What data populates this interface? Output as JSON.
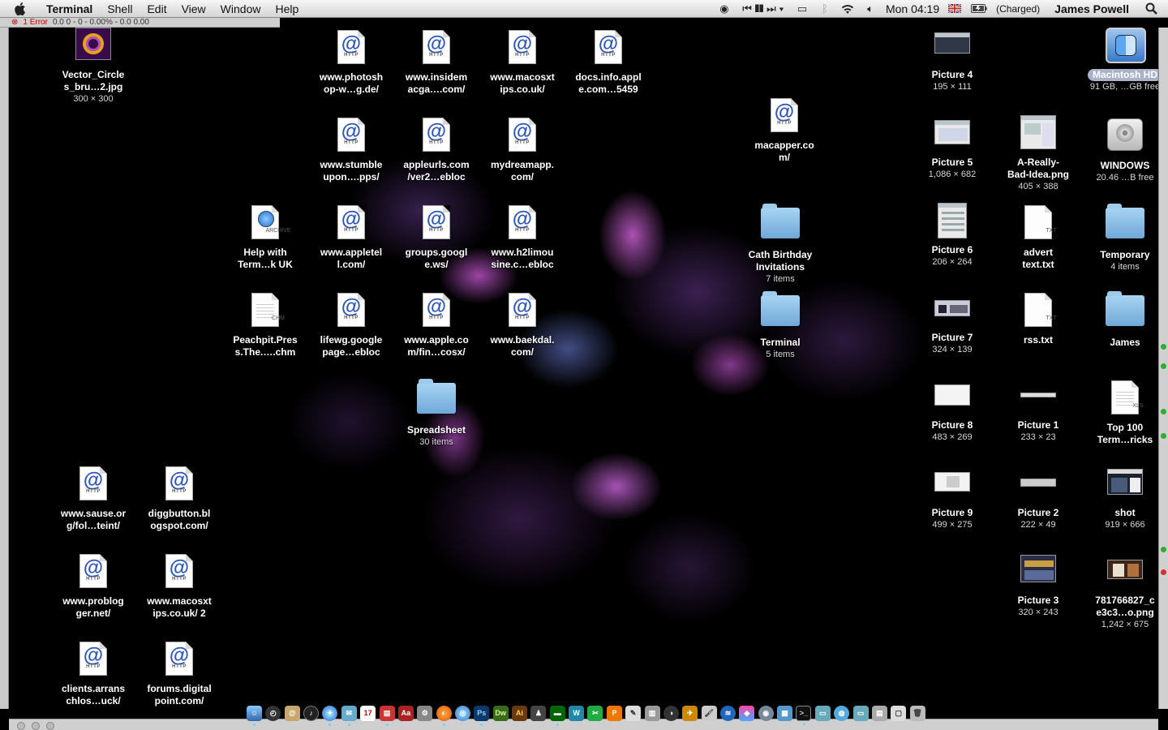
{
  "menubar": {
    "app_name": "Terminal",
    "menus": [
      "Shell",
      "Edit",
      "View",
      "Window",
      "Help"
    ],
    "clock": "Mon 04:19",
    "battery_status": "(Charged)",
    "user": "James Powell",
    "icons": [
      "apple-logo-icon",
      "activity-icon",
      "media-controls-icon",
      "display-icon",
      "bluetooth-icon",
      "wifi-icon",
      "volume-icon",
      "uk-flag-icon",
      "battery-icon",
      "spotlight-icon"
    ]
  },
  "background_window": {
    "error_text": "1 Error",
    "status_text": "0.0    0 - 0 - 0.00%  - 0.0 0.00"
  },
  "desktop": {
    "icons_left": [
      {
        "name": "Vector_Circles_bru…2.jpg",
        "line1": "Vector_Circle",
        "line2": "s_bru…2.jpg",
        "meta": "300 × 300",
        "type": "image"
      },
      {
        "line1": "www.sause.or",
        "line2": "g/fol…teint/",
        "type": "http"
      },
      {
        "line1": "diggbutton.bl",
        "line2": "ogspot.com/",
        "type": "http"
      },
      {
        "line1": "www.problog",
        "line2": "ger.net/",
        "type": "http"
      },
      {
        "line1": "www.macosxt",
        "line2": "ips.co.uk/ 2",
        "type": "http"
      },
      {
        "line1": "clients.arrans",
        "line2": "chlos…uck/",
        "type": "http"
      },
      {
        "line1": "forums.digital",
        "line2": "point.com/",
        "type": "http"
      }
    ],
    "icons_middle": [
      {
        "line1": "www.photosh",
        "line2": "op-w…g.de/",
        "type": "http"
      },
      {
        "line1": "www.insidem",
        "line2": "acga….com/",
        "type": "http"
      },
      {
        "line1": "www.macosxt",
        "line2": "ips.co.uk/",
        "type": "http"
      },
      {
        "line1": "docs.info.appl",
        "line2": "e.com…5459",
        "type": "http"
      },
      {
        "line1": "www.stumble",
        "line2": "upon….pps/",
        "type": "http"
      },
      {
        "line1": "appleurls.com",
        "line2": "/ver2…ebloc",
        "type": "http"
      },
      {
        "line1": "mydreamapp.",
        "line2": "com/",
        "type": "http"
      },
      {
        "line1": "Help with",
        "line2": "Term…k UK",
        "type": "archive"
      },
      {
        "line1": "www.appletel",
        "line2": "l.com/",
        "type": "http"
      },
      {
        "line1": "groups.googl",
        "line2": "e.ws/",
        "type": "http"
      },
      {
        "line1": "www.h2limou",
        "line2": "sine.c…ebloc",
        "type": "http"
      },
      {
        "line1": "Peachpit.Pres",
        "line2": "s.The.….chm",
        "type": "chm"
      },
      {
        "line1": "lifewg.google",
        "line2": "page…ebloc",
        "type": "http"
      },
      {
        "line1": "www.apple.co",
        "line2": "m/fin…cosx/",
        "type": "http"
      },
      {
        "line1": "www.baekdal.",
        "line2": "com/",
        "type": "http"
      },
      {
        "line1": "Spreadsheet",
        "line2": "",
        "meta": "30 items",
        "type": "folder"
      },
      {
        "line1": "macapper.co",
        "line2": "m/",
        "type": "http"
      },
      {
        "line1": "Cath Birthday",
        "line2": "Invitations",
        "meta": "7 items",
        "type": "folder"
      },
      {
        "line1": "Terminal",
        "line2": "",
        "meta": "5 items",
        "type": "folder"
      }
    ],
    "icons_right": [
      {
        "line1": "Picture 4",
        "meta": "195 × 111"
      },
      {
        "line1": "Macintosh HD",
        "meta": "91 GB, …GB free"
      },
      {
        "line1": "Picture 5",
        "meta": "1,086 × 682"
      },
      {
        "line1": "A-Really-",
        "line2": "Bad-Idea.png",
        "meta": "405 × 388"
      },
      {
        "line1": "WINDOWS",
        "meta": "20.46 …B free"
      },
      {
        "line1": "Picture 6",
        "meta": "206 × 264"
      },
      {
        "line1": "advert",
        "line2": "text.txt"
      },
      {
        "line1": "Temporary",
        "meta": "4 items"
      },
      {
        "line1": "Picture 7",
        "meta": "324 × 139"
      },
      {
        "line1": "rss.txt"
      },
      {
        "line1": "James"
      },
      {
        "line1": "Picture 8",
        "meta": "483 × 269"
      },
      {
        "line1": "Picture 1",
        "meta": "233 × 23"
      },
      {
        "line1": "Top 100",
        "line2": "Term…ricks"
      },
      {
        "line1": "Picture 9",
        "meta": "499 × 275"
      },
      {
        "line1": "Picture 2",
        "meta": "222 × 49"
      },
      {
        "line1": "shot",
        "meta": "919 × 666"
      },
      {
        "line1": "Picture 3",
        "meta": "320 × 243"
      },
      {
        "line1": "781766827_c",
        "line2": "e3c3…o.png",
        "meta": "1,242 × 675"
      }
    ],
    "doc_tags": {
      "http": "HTTP",
      "archive": "ARCHIVE",
      "chm": "CHM",
      "txt": "TXT",
      "xls": "XLS"
    }
  },
  "dock": {
    "items": [
      "finder-icon",
      "dashboard-icon",
      "address-book-icon",
      "itunes-icon",
      "safari-icon",
      "mail-icon",
      "ical-icon",
      "preview-icon",
      "dictionary-icon",
      "system-prefs-icon",
      "firefox-icon",
      "camino-icon",
      "photoshop-icon",
      "dreamweaver-icon",
      "illustrator-icon",
      "app-icon",
      "app-icon",
      "app-icon",
      "app-icon",
      "app-icon",
      "app-icon",
      "app-icon",
      "app-icon",
      "app-icon",
      "app-icon",
      "app-icon",
      "app-icon",
      "app-icon",
      "app-icon",
      "app-icon",
      "app-icon",
      "terminal-icon",
      "folder-icon",
      "folder-icon",
      "folder-icon",
      "folder-icon",
      "folder-icon",
      "trash-icon"
    ],
    "labels": {
      "ps": "Ps",
      "dw": "Dw",
      "ai": "Ai"
    }
  }
}
